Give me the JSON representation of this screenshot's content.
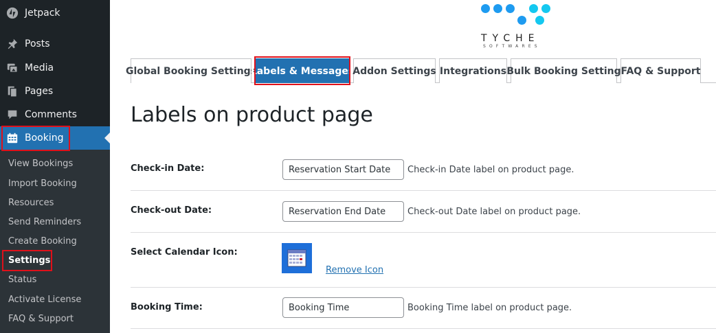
{
  "sidebar": {
    "items": [
      {
        "label": "Jetpack",
        "icon": "jetpack-icon"
      },
      {
        "label": "Posts",
        "icon": "pin-icon"
      },
      {
        "label": "Media",
        "icon": "media-icon"
      },
      {
        "label": "Pages",
        "icon": "pages-icon"
      },
      {
        "label": "Comments",
        "icon": "comment-icon"
      },
      {
        "label": "Booking",
        "icon": "calendar-icon",
        "active": true
      }
    ],
    "submenu": [
      "View Bookings",
      "Import Booking",
      "Resources",
      "Send Reminders",
      "Create Booking",
      "Settings",
      "Status",
      "Activate License",
      "FAQ & Support"
    ],
    "current_sub": "Settings",
    "colors": {
      "bg": "#1d2327",
      "active": "#2271b1",
      "highlight": "#e0101a"
    }
  },
  "logo": {
    "word": "TYCHE",
    "sub": "SOFTWARES",
    "dot_colors": [
      "#1e9bf0",
      "#14c8f0"
    ]
  },
  "tabs": [
    {
      "label": "Global Booking Settings"
    },
    {
      "label": "Labels & Messages",
      "active": true
    },
    {
      "label": "Addon Settings"
    },
    {
      "label": "Integrations"
    },
    {
      "label": "Bulk Booking Setting"
    },
    {
      "label": "FAQ & Support"
    }
  ],
  "page": {
    "title": "Labels on product page",
    "rows": {
      "checkin": {
        "label": "Check-in Date:",
        "value": "Reservation Start Date",
        "desc": "Check-in Date label on product page."
      },
      "checkout": {
        "label": "Check-out Date:",
        "value": "Reservation End Date",
        "desc": "Check-out Date label on product page."
      },
      "calendar": {
        "label": "Select Calendar Icon:",
        "remove": "Remove Icon"
      },
      "time": {
        "label": "Booking Time:",
        "value": "Booking Time",
        "desc": "Booking Time label on product page."
      }
    }
  }
}
